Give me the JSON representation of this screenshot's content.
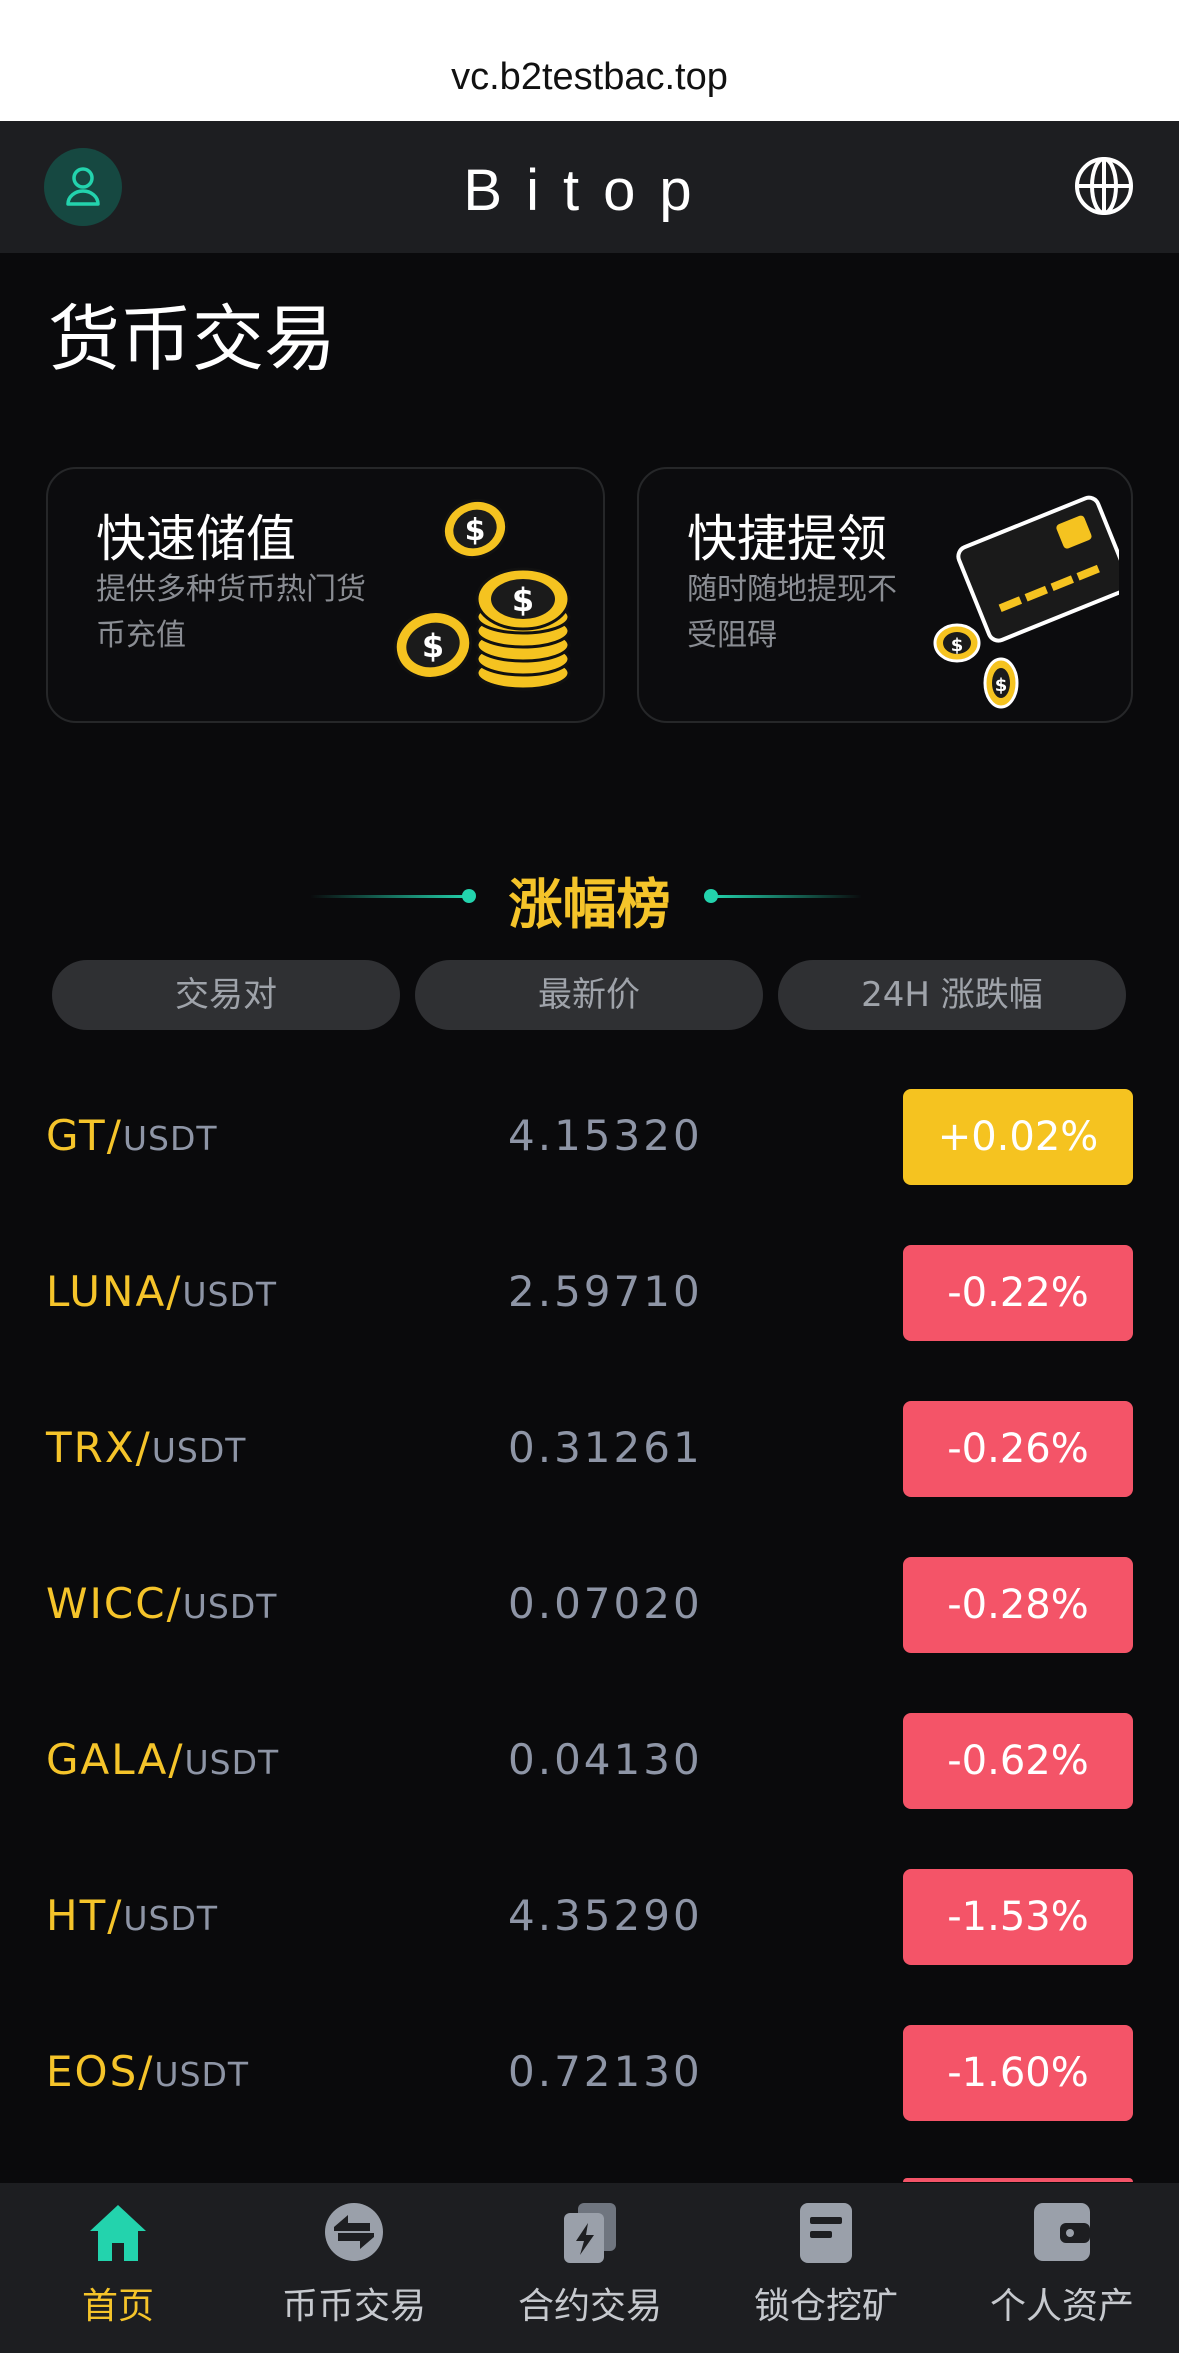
{
  "browser": {
    "url": "vc.b2testbac.top"
  },
  "header": {
    "brand": "Bitop"
  },
  "page": {
    "title": "货币交易"
  },
  "cards": [
    {
      "title": "快速储值",
      "desc": "提供多种货币热门货币充值",
      "icon": "coins-stack-icon"
    },
    {
      "title": "快捷提领",
      "desc": "随时随地提现不受阻碍",
      "icon": "bank-card-icon"
    }
  ],
  "ranking": {
    "title": "涨幅榜",
    "columns": [
      "交易对",
      "最新价",
      "24H 涨跌幅"
    ],
    "rows": [
      {
        "base": "GT",
        "quote": "USDT",
        "price": "4.15320",
        "change": "+0.02%",
        "direction": "up"
      },
      {
        "base": "LUNA",
        "quote": "USDT",
        "price": "2.59710",
        "change": "-0.22%",
        "direction": "down"
      },
      {
        "base": "TRX",
        "quote": "USDT",
        "price": "0.31261",
        "change": "-0.26%",
        "direction": "down"
      },
      {
        "base": "WICC",
        "quote": "USDT",
        "price": "0.07020",
        "change": "-0.28%",
        "direction": "down"
      },
      {
        "base": "GALA",
        "quote": "USDT",
        "price": "0.04130",
        "change": "-0.62%",
        "direction": "down"
      },
      {
        "base": "HT",
        "quote": "USDT",
        "price": "4.35290",
        "change": "-1.53%",
        "direction": "down"
      },
      {
        "base": "EOS",
        "quote": "USDT",
        "price": "0.72130",
        "change": "-1.60%",
        "direction": "down"
      }
    ]
  },
  "nav": {
    "tabs": [
      {
        "label": "首页",
        "icon": "home-icon",
        "active": true
      },
      {
        "label": "币币交易",
        "icon": "exchange-icon",
        "active": false
      },
      {
        "label": "合约交易",
        "icon": "contract-icon",
        "active": false
      },
      {
        "label": "锁仓挖矿",
        "icon": "mining-icon",
        "active": false
      },
      {
        "label": "个人资产",
        "icon": "wallet-icon",
        "active": false
      }
    ]
  },
  "colors": {
    "accent": "#f5c42a",
    "up": "#f5c320",
    "down": "#f45468",
    "teal": "#23d3ad",
    "background": "#0a0a0c"
  }
}
